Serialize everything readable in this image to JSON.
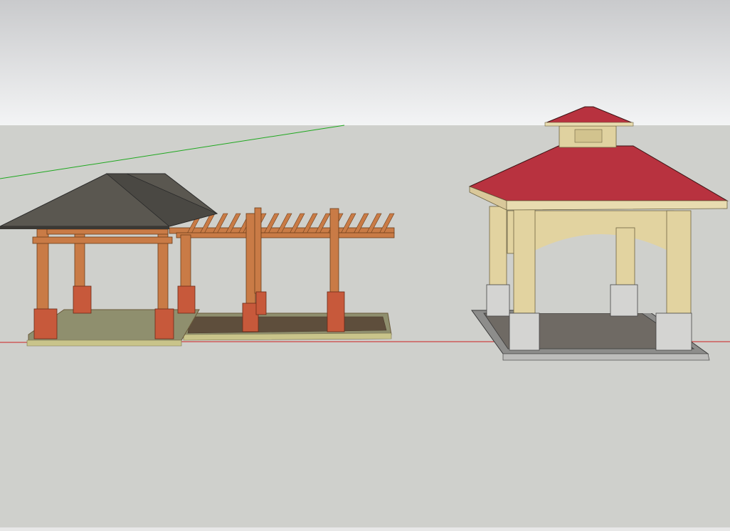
{
  "viewport": {
    "sky_top_color": "#c9cacc",
    "sky_bottom_color": "#f3f4f5",
    "ground_color": "#cfd0cc",
    "bottom_strip_color": "#e8e8e8",
    "green_axis_color": "#1fa81f",
    "red_axis_color": "#cc1f1f"
  },
  "models": [
    {
      "name": "hip-roof-pavilion-with-pergola",
      "roof_color": "#5a5750",
      "timber_color": "#c97b46",
      "pier_color": "#c7593b",
      "floor_color": "#8f8f6e"
    },
    {
      "name": "red-roof-gazebo-with-cupola",
      "roof_color": "#b8323f",
      "timber_color": "#e2d3a0",
      "base_color": "#d4d4d2",
      "floor_color": "#6f6a64"
    }
  ]
}
